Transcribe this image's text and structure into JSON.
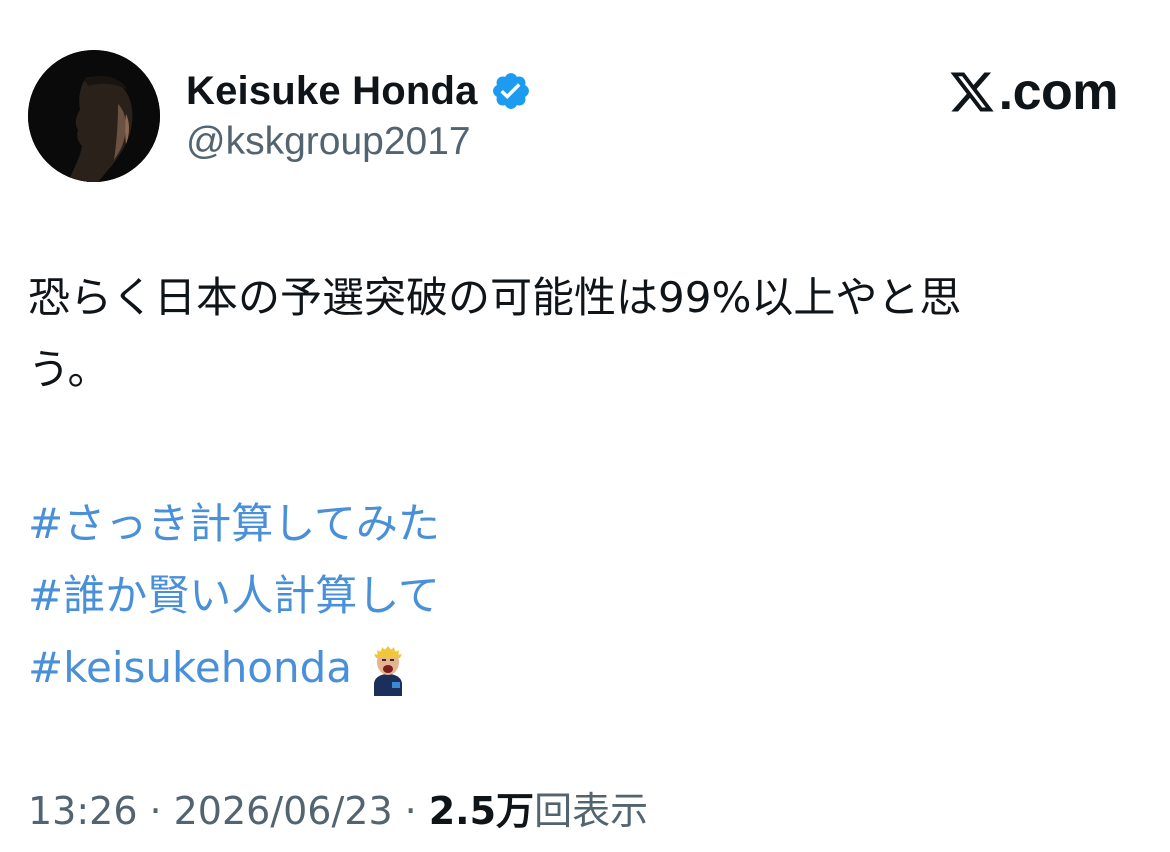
{
  "author": {
    "display_name": "Keisuke Honda",
    "handle": "@kskgroup2017",
    "verified": true,
    "avatar_icon": "profile-photo-avatar"
  },
  "brand": {
    "logo_glyph": "X",
    "domain": ".com"
  },
  "tweet": {
    "text_lines": [
      "恐らく日本の予選突破の可能性は99%以上やと思",
      "う。"
    ],
    "hashtags": [
      "#さっき計算してみた",
      "#誰か賢い人計算して",
      "#keisukehonda"
    ],
    "hashtag_emoji": "keisukehonda-hashflag-icon"
  },
  "meta": {
    "time": "13:26",
    "separator": "·",
    "date": "2026/06/23",
    "views_count": "2.5万",
    "views_label": "回表示"
  },
  "colors": {
    "hashtag": "#4a90d9",
    "verified_badge": "#1d9bf0",
    "secondary_text": "#536471",
    "primary_text": "#0f1419"
  }
}
